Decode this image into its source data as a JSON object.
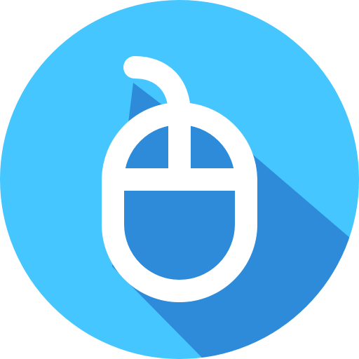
{
  "icon": {
    "semantic_name": "computer-mouse-icon",
    "style": "flat circular badge with long shadow",
    "colors": {
      "background_circle": "#45C6FF",
      "long_shadow": "#2E8BD9",
      "mouse_fill": "#2E8BD9",
      "mouse_outline": "#FFFFFF"
    }
  }
}
